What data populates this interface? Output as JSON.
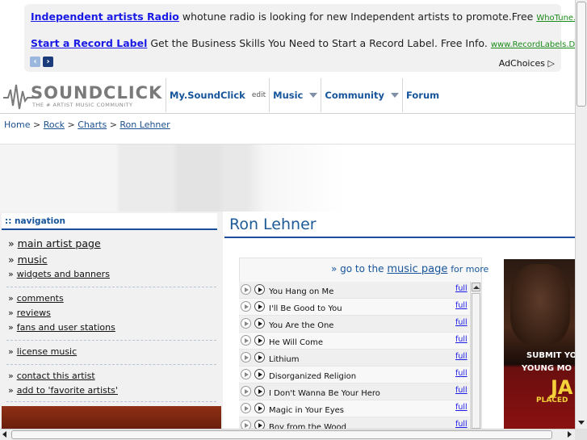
{
  "ads": [
    {
      "title": "Independent artists Radio",
      "text": "whotune radio is looking for new Independent artists to promote.Free",
      "url": "WhoTune.com"
    },
    {
      "title": "Start a Record Label",
      "text": "Get the Business Skills You Need to Start a Record Label. Free Info.",
      "url": "www.RecordLabels.DegreeLeap.com"
    }
  ],
  "adchoices": "AdChoices ▷",
  "logo": {
    "name": "SOUNDCLICK",
    "tagline": "THE # ARTIST MUSIC COMMUNITY"
  },
  "nav": {
    "mysoundclick": "My.SoundClick",
    "edit": "edit",
    "music": "Music",
    "community": "Community",
    "forum": "Forum"
  },
  "breadcrumb": {
    "home": "Home",
    "sep": ">",
    "rock": "Rock",
    "charts": "Charts",
    "artist": "Ron Lehner"
  },
  "sidebar": {
    "heading": ":: navigation",
    "items": [
      {
        "label": "main artist page"
      },
      {
        "label": "music"
      },
      {
        "label": "widgets and banners"
      },
      {
        "label": "comments"
      },
      {
        "label": "reviews"
      },
      {
        "label": "fans and user stations"
      },
      {
        "label": "license music"
      },
      {
        "label": "contact this artist"
      },
      {
        "label": "add to 'favorite artists'"
      }
    ]
  },
  "artist_name": "Ron Lehner",
  "player": {
    "goto_prefix": "go to the",
    "music_page": "music page",
    "goto_suffix": "for more",
    "tracks": [
      {
        "title": "You Hang on Me",
        "full": "full"
      },
      {
        "title": "I'll Be Good to You",
        "full": "full"
      },
      {
        "title": "You Are the One",
        "full": "full"
      },
      {
        "title": "He Will Come",
        "full": "full"
      },
      {
        "title": "Lithium",
        "full": "full"
      },
      {
        "title": "Disorganized Religion",
        "full": "full"
      },
      {
        "title": "I Don't Wanna Be Your Hero",
        "full": "full"
      },
      {
        "title": "Magic in Your Eyes",
        "full": "full"
      },
      {
        "title": "Boy from the Wood",
        "full": "full"
      }
    ]
  },
  "promo": {
    "line1": "SUBMIT YO",
    "line2": "YOUNG MO",
    "line3": "JA",
    "line4": "PLACED"
  }
}
